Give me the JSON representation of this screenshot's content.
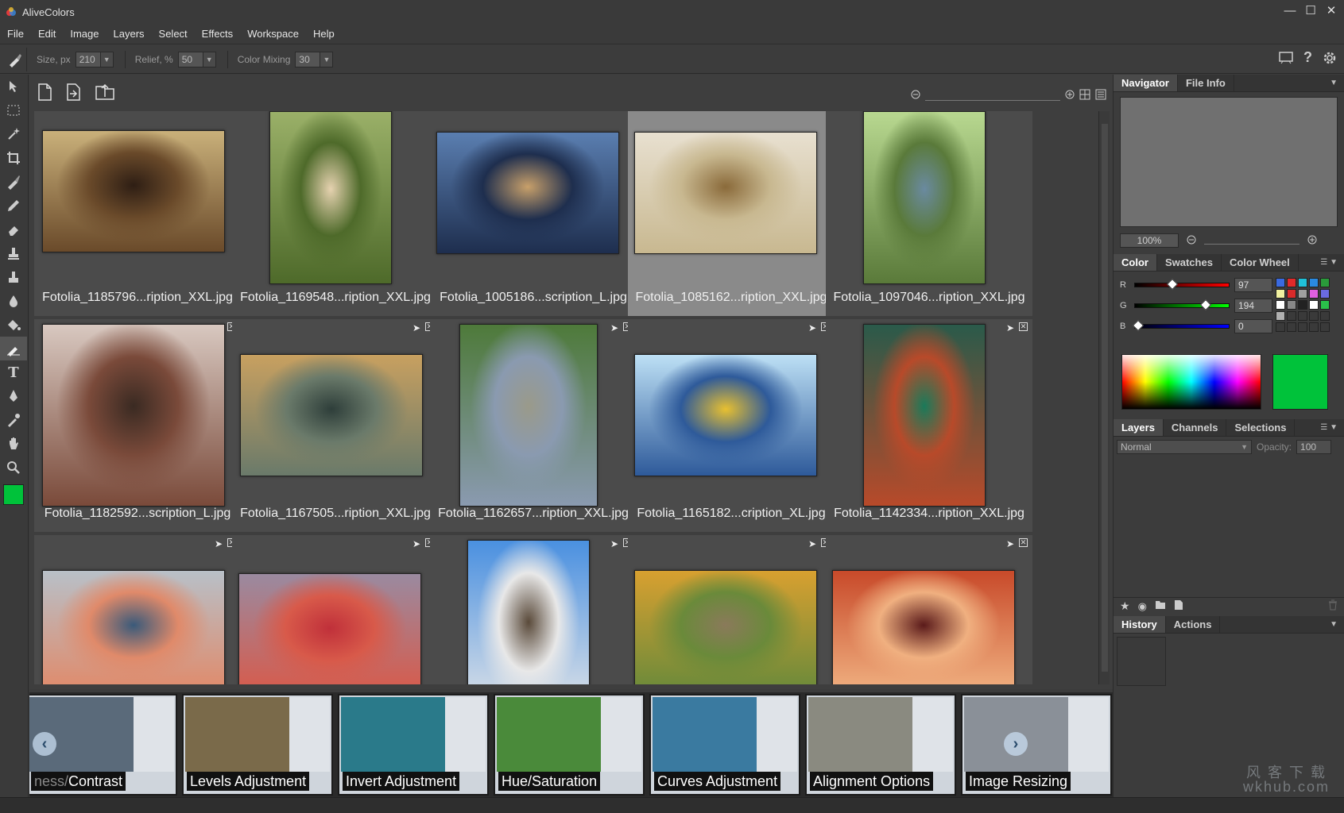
{
  "app": {
    "title": "AliveColors"
  },
  "menu": [
    "File",
    "Edit",
    "Image",
    "Layers",
    "Select",
    "Effects",
    "Workspace",
    "Help"
  ],
  "options": {
    "size_label": "Size, px",
    "size_value": "210",
    "relief_label": "Relief, %",
    "relief_value": "50",
    "mixing_label": "Color Mixing",
    "mixing_value": "30"
  },
  "files": [
    {
      "name": "Fotolia_1185796...ription_XXL.jpg",
      "colors": [
        "#c9b07a",
        "#6a4a2a",
        "#2e1e14"
      ],
      "selected": false
    },
    {
      "name": "Fotolia_1169548...ription_XXL.jpg",
      "colors": [
        "#9ab068",
        "#4e6a2a",
        "#e6d2b0"
      ],
      "selected": false
    },
    {
      "name": "Fotolia_1005186...scription_L.jpg",
      "colors": [
        "#5a7eb0",
        "#1e2e4e",
        "#c8a06a"
      ],
      "selected": false
    },
    {
      "name": "Fotolia_1085162...ription_XXL.jpg",
      "colors": [
        "#e8e0d0",
        "#c8b890",
        "#8a6a3a"
      ],
      "selected": true
    },
    {
      "name": "Fotolia_1097046...ription_XXL.jpg",
      "colors": [
        "#b8d890",
        "#5a7a3a",
        "#6a8aa0"
      ],
      "selected": false
    },
    {
      "name": "Fotolia_1182592...scription_L.jpg",
      "colors": [
        "#d8c8c0",
        "#7a4a3a",
        "#3a2a22"
      ],
      "selected": false
    },
    {
      "name": "Fotolia_1167505...ription_XXL.jpg",
      "colors": [
        "#c8a060",
        "#6a7a6a",
        "#2e3e3a"
      ],
      "selected": false
    },
    {
      "name": "Fotolia_1162657...ription_XXL.jpg",
      "colors": [
        "#4e7a3a",
        "#8a9ab0",
        "#9a9a8a"
      ],
      "selected": false
    },
    {
      "name": "Fotolia_1165182...cription_XL.jpg",
      "colors": [
        "#bde0f5",
        "#2e5a9a",
        "#e8c030"
      ],
      "selected": false
    },
    {
      "name": "Fotolia_1142334...ription_XXL.jpg",
      "colors": [
        "#2a5a4a",
        "#b84a2a",
        "#1a7a5a"
      ],
      "selected": false
    },
    {
      "name": "",
      "colors": [
        "#b8c0c8",
        "#e08a6a",
        "#3a5a7a"
      ],
      "selected": false
    },
    {
      "name": "",
      "colors": [
        "#9a8aa0",
        "#d85a4a",
        "#c0303a"
      ],
      "selected": false
    },
    {
      "name": "",
      "colors": [
        "#4a90e0",
        "#e8e8e8",
        "#5a4a3a"
      ],
      "selected": false
    },
    {
      "name": "",
      "colors": [
        "#d8a030",
        "#6a8a3a",
        "#8a7a5a"
      ],
      "selected": false
    },
    {
      "name": "",
      "colors": [
        "#c84a2a",
        "#f0b080",
        "#5a1a1a"
      ],
      "selected": false
    }
  ],
  "filmstrip": [
    {
      "label": "Contrast",
      "prefix": "ness/",
      "color": "#5a6a7a"
    },
    {
      "label": "Levels Adjustment",
      "prefix": "",
      "color": "#7a6a4a"
    },
    {
      "label": "Invert Adjustment",
      "prefix": "",
      "color": "#2a7a8a"
    },
    {
      "label": "Hue/Saturation",
      "prefix": "",
      "color": "#4a8a3a"
    },
    {
      "label": "Curves Adjustment",
      "prefix": "",
      "color": "#3a7aa0"
    },
    {
      "label": "Alignment Options",
      "prefix": "",
      "color": "#8a8a80"
    },
    {
      "label": "Image Resizing",
      "prefix": "",
      "color": "#8a9098"
    }
  ],
  "panels": {
    "navigator_tabs": [
      "Navigator",
      "File Info"
    ],
    "navigator_zoom": "100%",
    "color_tabs": [
      "Color",
      "Swatches",
      "Color Wheel"
    ],
    "channels": [
      {
        "label": "R",
        "value": "97",
        "pos": 0.38
      },
      {
        "label": "G",
        "value": "194",
        "pos": 0.76
      },
      {
        "label": "B",
        "value": "0",
        "pos": 0.0
      }
    ],
    "current_color": "#00c23a",
    "swatches": [
      "#3a6ae0",
      "#e02a2a",
      "#20c0d8",
      "#2a8ae0",
      "#2a9a3a",
      "#f0f0a0",
      "#d82a2a",
      "#a0a0a0",
      "#e060e0",
      "#6a6ae0",
      "#ffffff",
      "#888888",
      "#222222",
      "#ffffff",
      "#2ac04a",
      "#b0b0b0",
      "#3a3a3a",
      "#3a3a3a",
      "#3a3a3a",
      "#3a3a3a",
      "#3a3a3a",
      "#3a3a3a",
      "#3a3a3a",
      "#3a3a3a",
      "#3a3a3a"
    ],
    "layers_tabs": [
      "Layers",
      "Channels",
      "Selections"
    ],
    "blend_mode": "Normal",
    "opacity_label": "Opacity:",
    "opacity_value": "100",
    "history_tabs": [
      "History",
      "Actions"
    ]
  },
  "watermark": {
    "line1": "风 客 下 载",
    "line2": "wkhub.com"
  }
}
